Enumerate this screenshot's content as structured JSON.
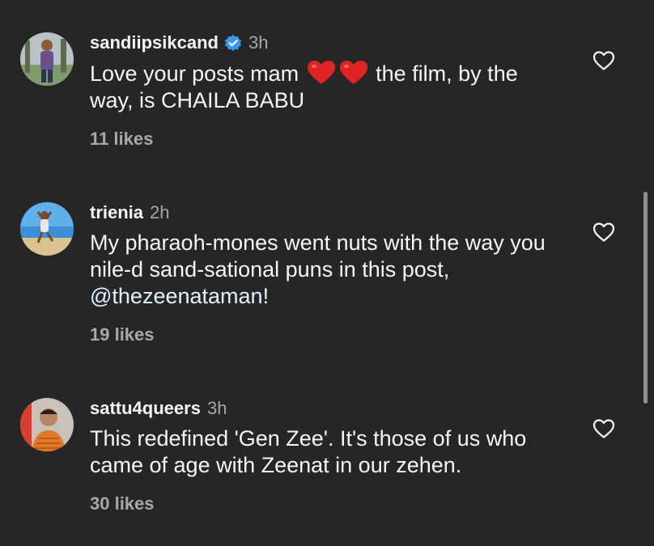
{
  "comments": [
    {
      "username": "sandiipsikcand",
      "verified": true,
      "time": "3h",
      "text_before": "Love your posts mam",
      "emoji": "red-heart",
      "text_after": "the film, by the way, is CHAILA BABU",
      "likes": "11 likes"
    },
    {
      "username": "trienia",
      "verified": false,
      "time": "2h",
      "text_before": "My pharaoh-mones went nuts with the way you nile-d sand-sational puns in this post,",
      "mention": "@thezeenataman",
      "text_after": "!",
      "likes": "19 likes"
    },
    {
      "username": "sattu4queers",
      "verified": false,
      "time": "3h",
      "text_before": "This redefined 'Gen Zee'. It's those of us who came of age with Zeenat in our zehen.",
      "likes": "30 likes"
    }
  ],
  "icons": {
    "like": "heart-outline-icon",
    "verified": "verified-badge-icon"
  },
  "colors": {
    "background": "#262626",
    "text": "#f5f5f5",
    "muted": "#a8a8a8",
    "verified": "#3897f0",
    "emoji_heart": "#e02424"
  }
}
